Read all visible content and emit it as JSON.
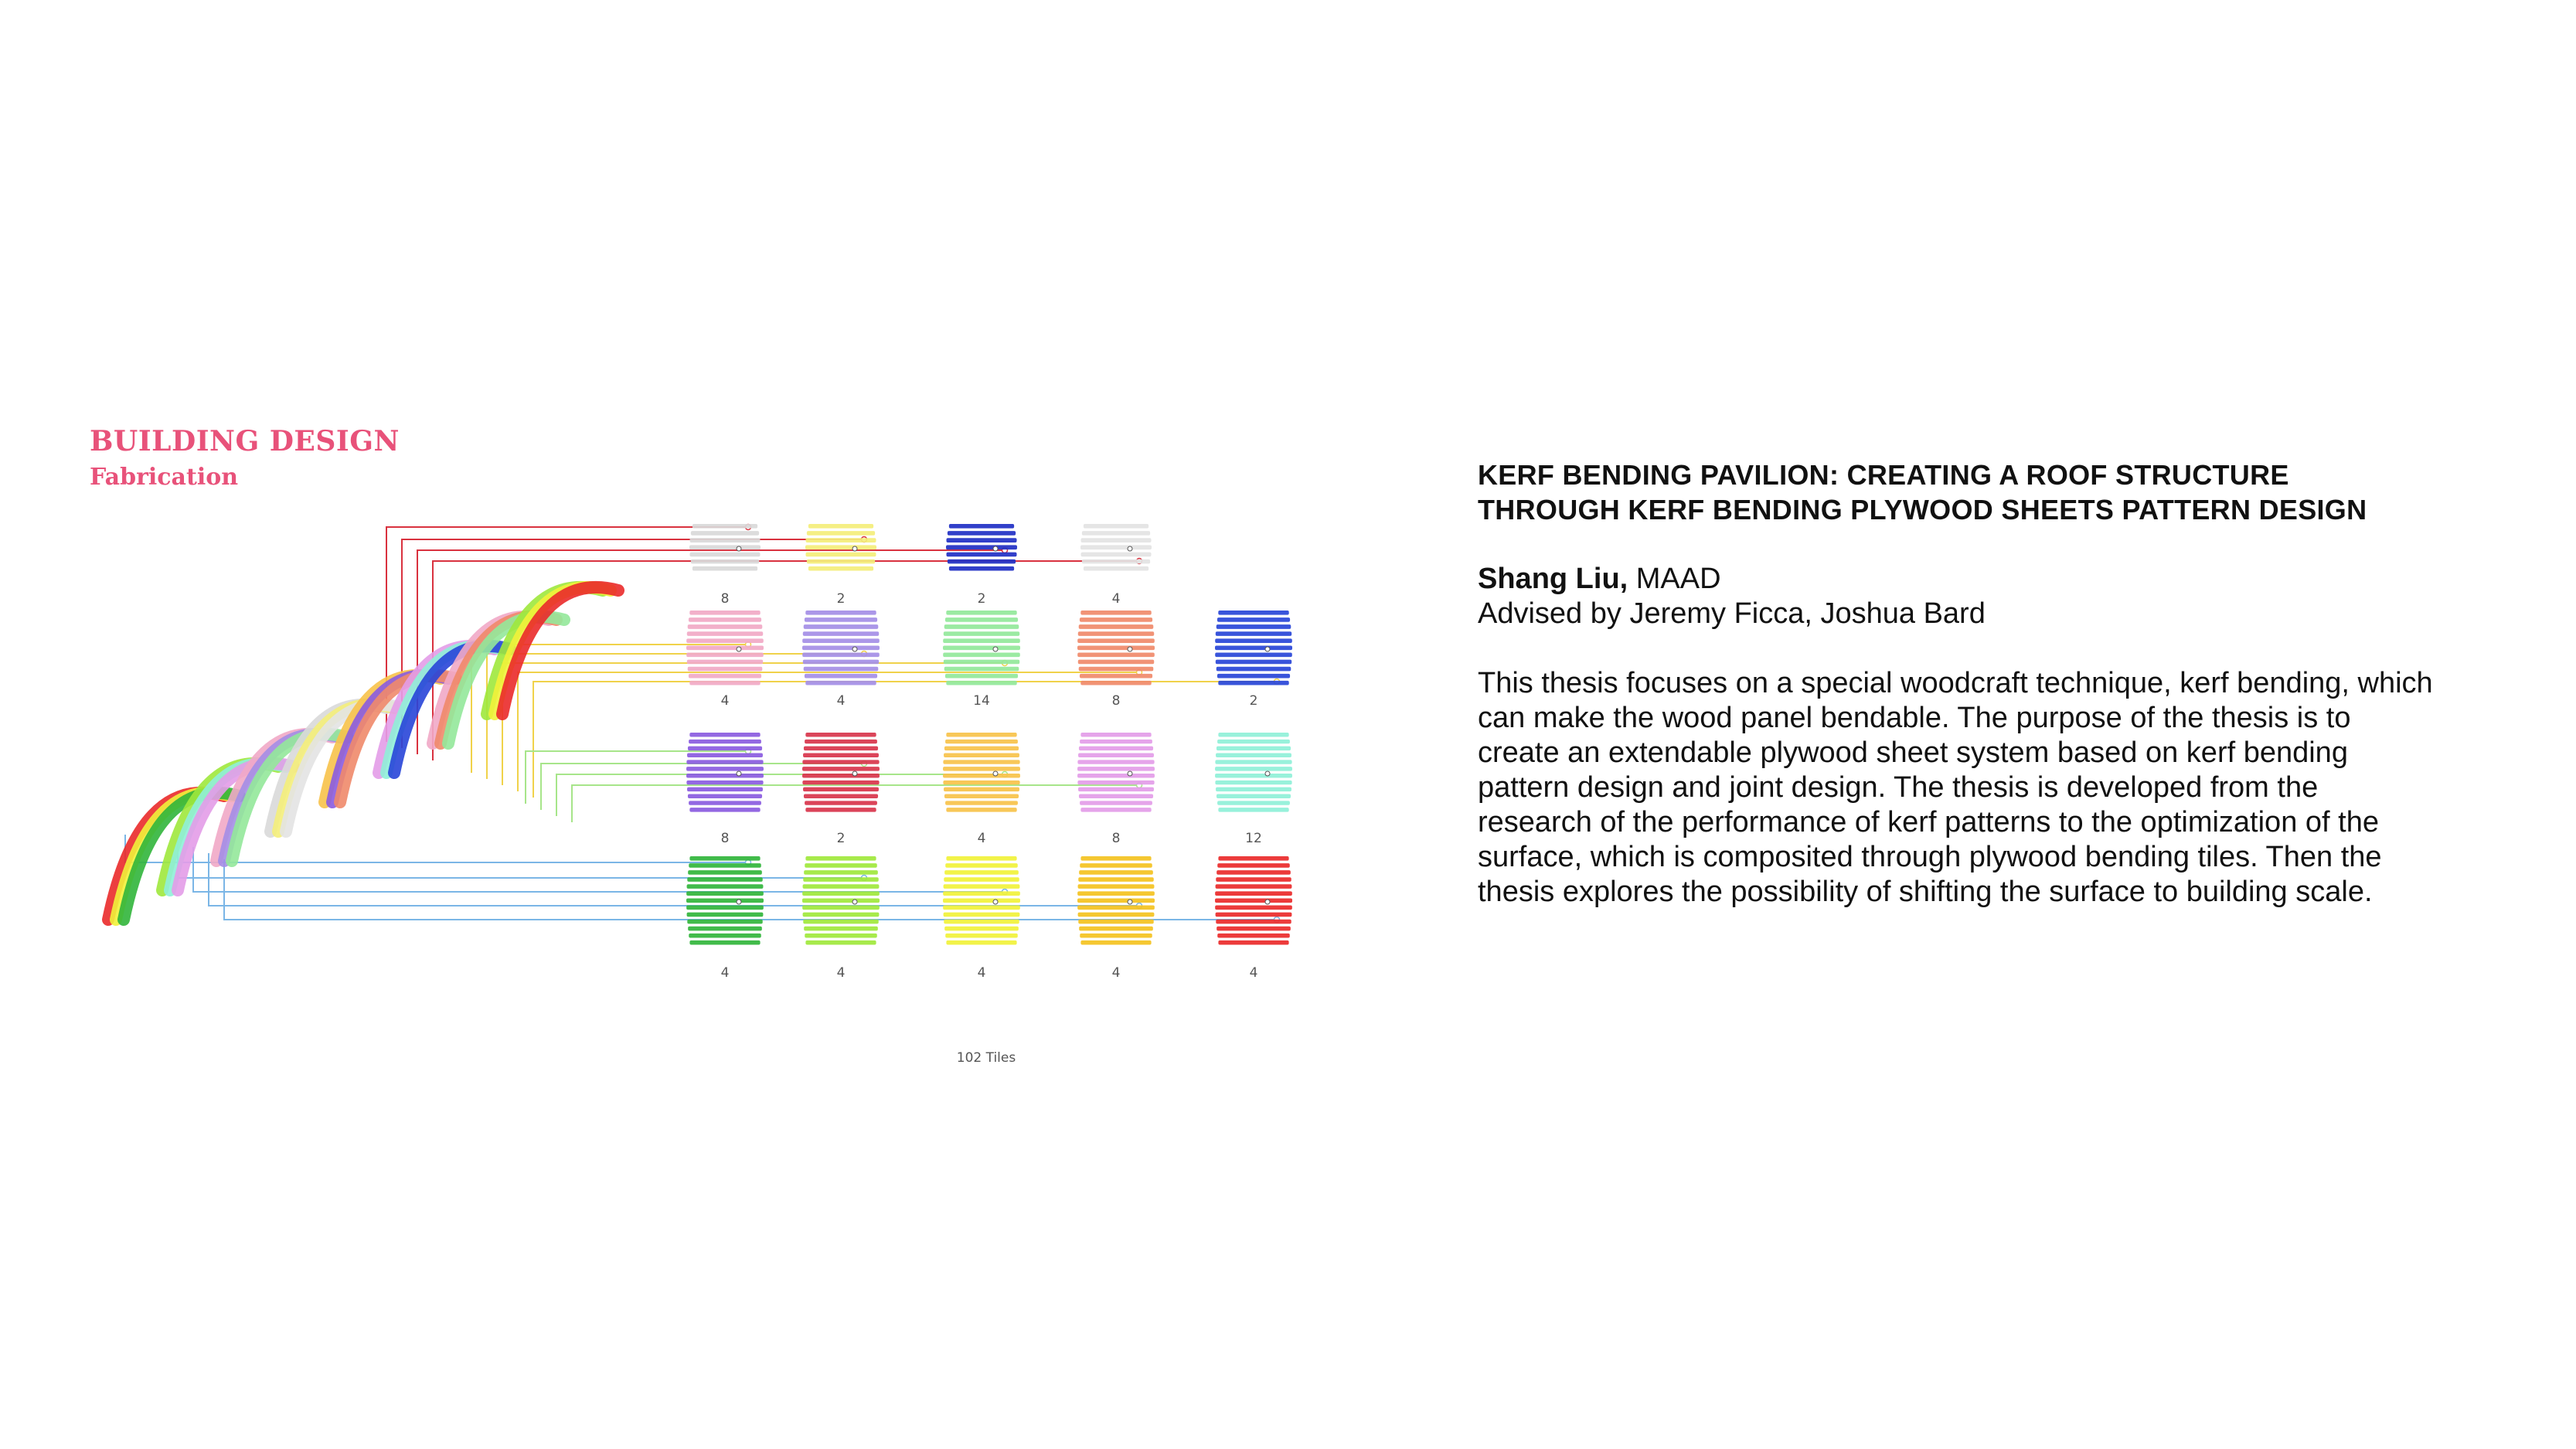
{
  "figure": {
    "title": "BUILDING DESIGN",
    "subtitle": "Fabrication",
    "total_label": "102 Tiles",
    "rows": [
      {
        "tiles": [
          {
            "count": "8",
            "color": "#d9d9d9"
          },
          {
            "count": "2",
            "color": "#f4ee7a"
          },
          {
            "count": "2",
            "color": "#1f2fc4"
          },
          {
            "count": "4",
            "color": "#e3e3e3"
          }
        ]
      },
      {
        "tiles": [
          {
            "count": "4",
            "color": "#f1a9c6"
          },
          {
            "count": "4",
            "color": "#a48ee6"
          },
          {
            "count": "14",
            "color": "#93e89a"
          },
          {
            "count": "8",
            "color": "#f08a6a"
          },
          {
            "count": "2",
            "color": "#2845d8"
          }
        ]
      },
      {
        "tiles": [
          {
            "count": "8",
            "color": "#8a5be0"
          },
          {
            "count": "2",
            "color": "#d8344b"
          },
          {
            "count": "4",
            "color": "#f7c24a"
          },
          {
            "count": "8",
            "color": "#e39ce8"
          },
          {
            "count": "12",
            "color": "#8ff0d8"
          }
        ]
      },
      {
        "tiles": [
          {
            "count": "4",
            "color": "#31b53b"
          },
          {
            "count": "4",
            "color": "#9fe83c"
          },
          {
            "count": "4",
            "color": "#f1f23a"
          },
          {
            "count": "4",
            "color": "#f4c21f"
          },
          {
            "count": "4",
            "color": "#ea2a2a"
          }
        ]
      }
    ]
  },
  "text": {
    "title": "KERF BENDING PAVILION: CREATING A ROOF STRUCTURE THROUGH KERF BENDING PLYWOOD SHEETS PATTERN DESIGN",
    "author_name": "Shang Liu,",
    "author_program": " MAAD",
    "advisors": "Advised by Jeremy Ficca, Joshua Bard",
    "abstract": "This thesis focuses on a special woodcraft technique, kerf bending, which can make the wood panel bendable. The purpose of the thesis is to create an extendable plywood sheet system based on kerf bending pattern design and joint design. The thesis is developed from the research of the performance of kerf patterns to the optimization of the surface, which is composited through plywood bending tiles. Then the thesis explores the possibility of shifting the surface to building scale."
  }
}
